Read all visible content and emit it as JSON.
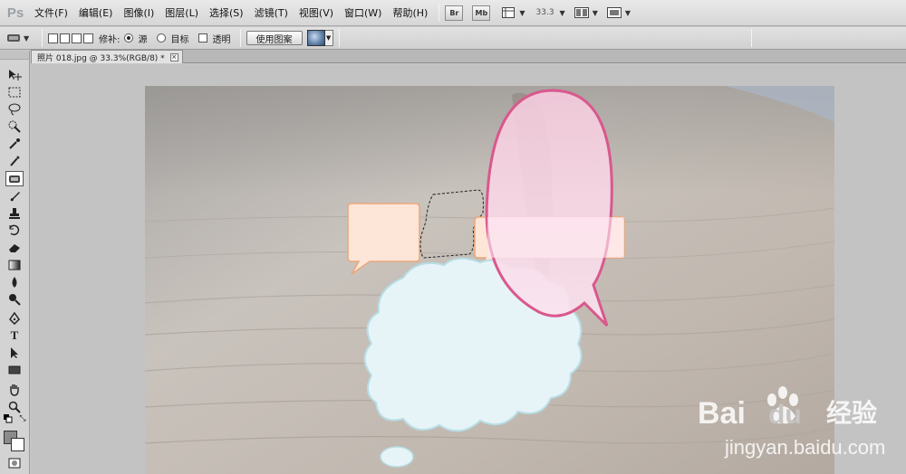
{
  "app": {
    "logo": "Ps"
  },
  "menu": [
    {
      "id": "file",
      "label": "文件(F)"
    },
    {
      "id": "edit",
      "label": "编辑(E)"
    },
    {
      "id": "image",
      "label": "图像(I)"
    },
    {
      "id": "layer",
      "label": "图层(L)"
    },
    {
      "id": "select",
      "label": "选择(S)"
    },
    {
      "id": "filter",
      "label": "滤镜(T)"
    },
    {
      "id": "view",
      "label": "视图(V)"
    },
    {
      "id": "window",
      "label": "窗口(W)"
    },
    {
      "id": "help",
      "label": "帮助(H)"
    }
  ],
  "app_toolbar": {
    "bridge": "Br",
    "mini_bridge": "Mb",
    "zoom": "33.3"
  },
  "options": {
    "repair_label": "修补:",
    "source_label": "源",
    "target_label": "目标",
    "transparent_label": "透明",
    "use_pattern_button": "使用图案",
    "source_selected": true,
    "transparent_checked": false
  },
  "document": {
    "tab_title": "照片 018.jpg @ 33.3%(RGB/8) *",
    "tab_close": "×"
  },
  "tools": [
    {
      "name": "move-tool",
      "icon": "move-icon",
      "glyph": "▸✥"
    },
    {
      "name": "marquee-tool",
      "icon": "marquee-icon",
      "glyph": "⬚"
    },
    {
      "name": "lasso-tool",
      "icon": "lasso-icon",
      "glyph": "ℓ"
    },
    {
      "name": "quick-select-tool",
      "icon": "quick-select-icon",
      "glyph": "✲"
    },
    {
      "name": "crop-tool",
      "icon": "crop-icon",
      "glyph": "⌗"
    },
    {
      "name": "eyedropper-tool",
      "icon": "eyedropper-icon",
      "glyph": "⁄"
    },
    {
      "name": "patch-tool",
      "icon": "patch-icon",
      "glyph": "❖"
    },
    {
      "name": "brush-tool",
      "icon": "brush-icon",
      "glyph": "✎"
    },
    {
      "name": "clone-stamp-tool",
      "icon": "stamp-icon",
      "glyph": "⊥"
    },
    {
      "name": "history-brush-tool",
      "icon": "history-brush-icon",
      "glyph": "⟲"
    },
    {
      "name": "eraser-tool",
      "icon": "eraser-icon",
      "glyph": "▱"
    },
    {
      "name": "gradient-tool",
      "icon": "gradient-icon",
      "glyph": "■"
    },
    {
      "name": "blur-tool",
      "icon": "blur-icon",
      "glyph": "◈"
    },
    {
      "name": "dodge-tool",
      "icon": "dodge-icon",
      "glyph": "●"
    },
    {
      "name": "pen-tool",
      "icon": "pen-icon",
      "glyph": "✒"
    },
    {
      "name": "type-tool",
      "icon": "type-icon",
      "glyph": "T"
    },
    {
      "name": "path-select-tool",
      "icon": "path-select-icon",
      "glyph": "➤"
    },
    {
      "name": "shape-tool",
      "icon": "rectangle-icon",
      "glyph": "▭"
    },
    {
      "name": "hand-tool",
      "icon": "hand-icon",
      "glyph": "✋"
    },
    {
      "name": "zoom-tool",
      "icon": "zoom-icon",
      "glyph": "⚲"
    },
    {
      "name": "quick-mask-tool",
      "icon": "quick-mask-icon",
      "glyph": "◙"
    }
  ],
  "colors": {
    "menubar": "#dcdcdc",
    "canvas_bg": "#c3c3c3",
    "pink_bubble": "#f4c9dc",
    "pink_stroke": "#d9588d",
    "peach_bubble": "#fde5d7",
    "peach_stroke": "#eaa77b",
    "cloud_fill": "#e6f4f8",
    "cloud_stroke": "#b7dde4"
  },
  "watermark": {
    "brand": "Bai",
    "brand2": "du",
    "brand_cn": "经验",
    "url": "jingyan.baidu.com"
  }
}
